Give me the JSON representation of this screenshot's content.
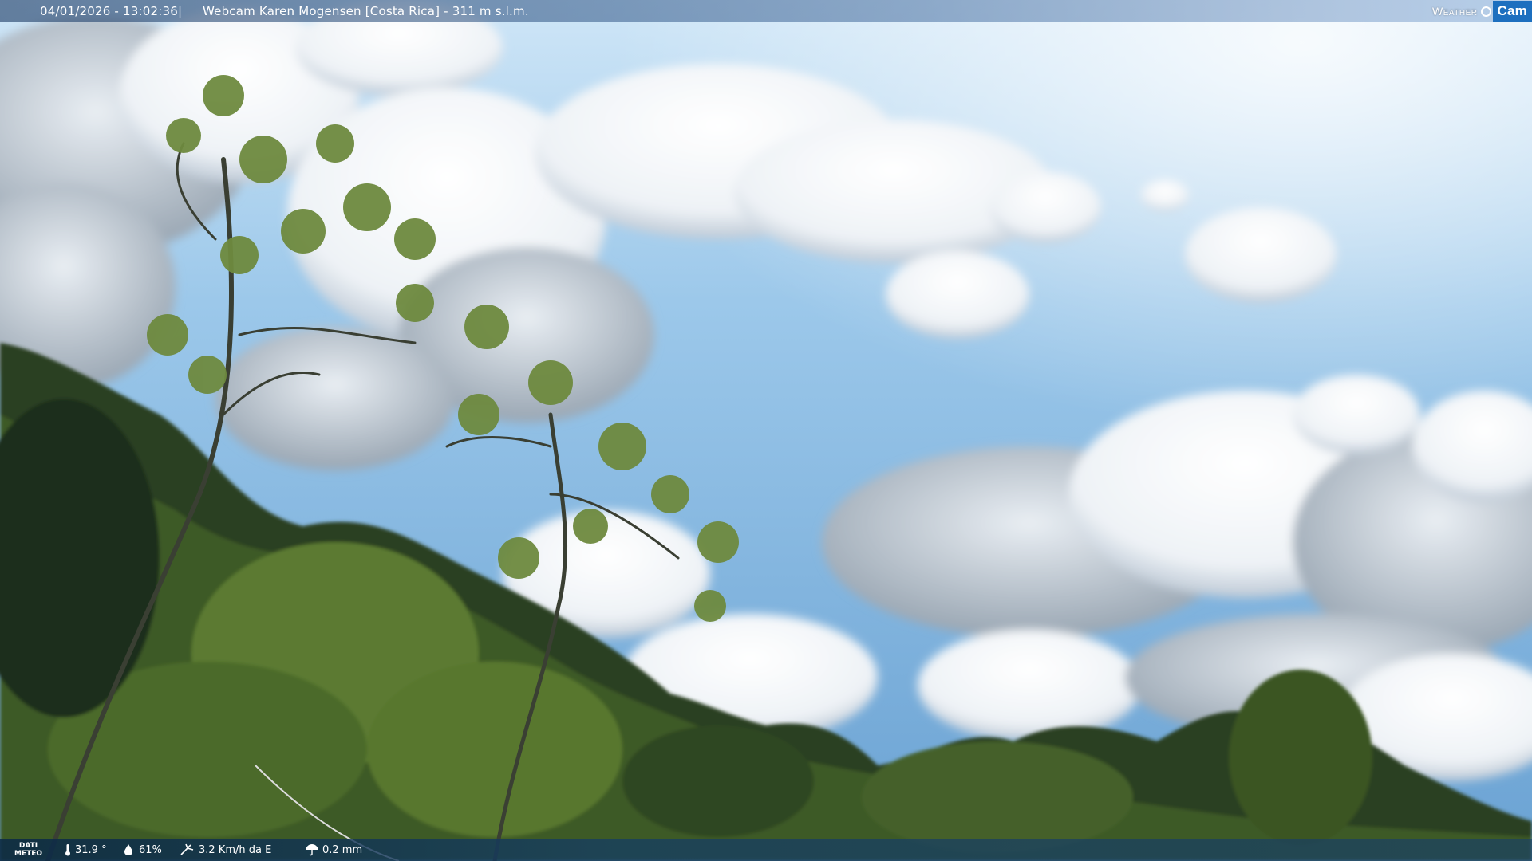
{
  "header": {
    "timestamp": "04/01/2026 - 13:02:36",
    "separator": "|",
    "title": "Webcam Karen Mogensen [Costa Rica] - 311 m s.l.m."
  },
  "brand": {
    "weather": "Weather",
    "cam": "Cam"
  },
  "weather_panel": {
    "label_line1": "DATI",
    "label_line2": "METEO",
    "temperature": "31.9 °",
    "humidity": "61%",
    "wind": "3.2 Km/h da E",
    "rain": "0.2 mm"
  },
  "colors": {
    "sky_top": "#cfe6f7",
    "sky_mid": "#7fb4df",
    "sky_bottom": "#6aa2d3",
    "cloud": "#f4f7fa",
    "cloud_shadow": "#b8c4cf",
    "foliage_dark": "#1f2e1a",
    "foliage_mid": "#3e5a26",
    "foliage_light": "#7f9b43"
  },
  "icons": {
    "temperature": "thermometer-icon",
    "humidity": "droplet-icon",
    "wind": "wind-icon",
    "rain": "umbrella-icon",
    "brand": "weather-cam-logo-icon"
  }
}
